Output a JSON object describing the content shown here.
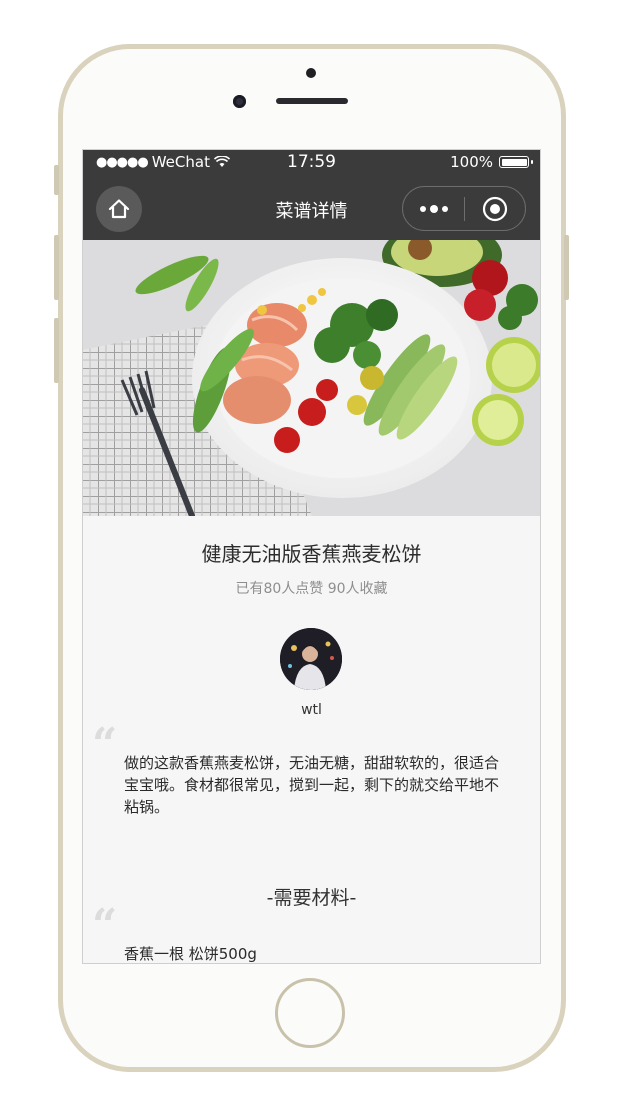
{
  "status_bar": {
    "signal_dots": "●●●●●",
    "carrier": "WeChat",
    "time": "17:59",
    "battery_percent": "100%",
    "battery_level": 1.0
  },
  "nav": {
    "title": "菜谱详情",
    "home_icon": "home-icon",
    "more_icon": "more-dots-icon",
    "close_icon": "target-close-icon"
  },
  "recipe": {
    "title": "健康无油版香蕉燕麦松饼",
    "stats": "已有80人点赞 90人收藏",
    "author": "wtl",
    "description": "做的这款香蕉燕麦松饼，无油无糖，甜甜软软的，很适合宝宝哦。食材都很常见，搅到一起，剩下的就交给平地不粘锅。",
    "ingredients_title": "-需要材料-",
    "ingredients": "香蕉一根 松饼500g"
  },
  "quote_mark": "“",
  "colors": {
    "navbar_bg": "#3b3b3b",
    "page_bg": "#f6f6f6",
    "phone_frame": "#d9d2bd"
  }
}
